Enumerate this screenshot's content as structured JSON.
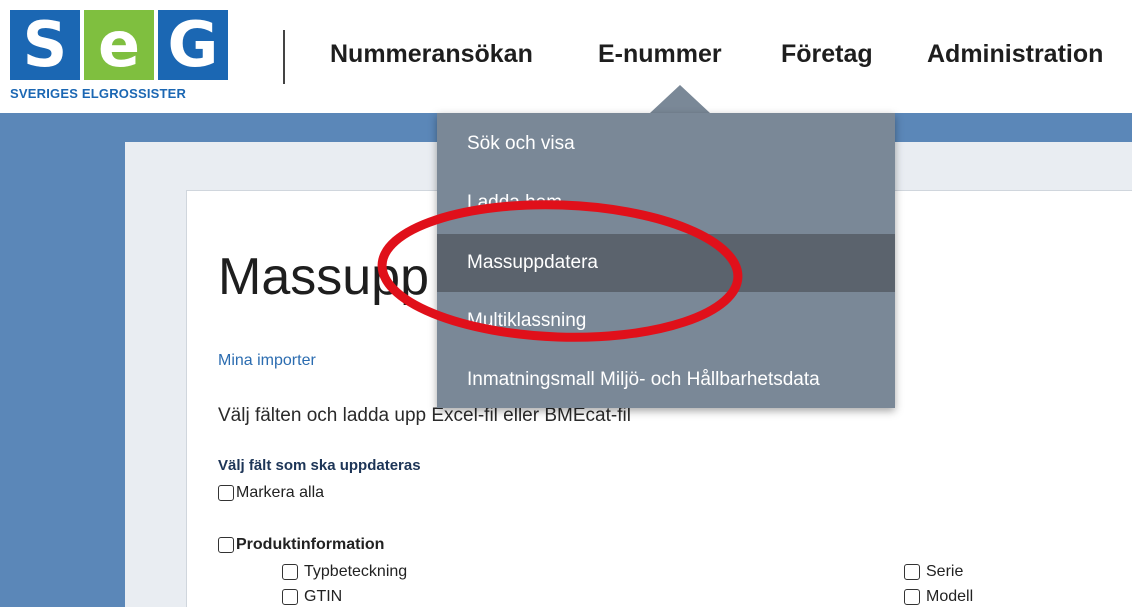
{
  "logo": {
    "letters": [
      "S",
      "e",
      "G"
    ],
    "subtitle": "SVERIGES ELGROSSISTER"
  },
  "nav": {
    "items": [
      "Nummeransökan",
      "E-nummer",
      "Företag",
      "Administration"
    ]
  },
  "dropdown": {
    "items": [
      "Sök och visa",
      "Ladda hem",
      "Massuppdatera",
      "Multiklassning",
      "Inmatningsmall Miljö- och Hållbarhetsdata"
    ],
    "active_index": 2
  },
  "page": {
    "title": "Massupp",
    "link": "Mina importer",
    "instruction": "Välj fälten och ladda upp Excel-fil eller BMEcat-fil",
    "section_label": "Välj fält som ska uppdateras",
    "select_all": "Markera alla",
    "group": "Produktinformation",
    "fields_left": [
      "Typbeteckning",
      "GTIN"
    ],
    "fields_right": [
      "Serie",
      "Modell"
    ]
  },
  "colors": {
    "brand_blue": "#1b67b3",
    "brand_green": "#7fbf3f",
    "band": "#5b87b8",
    "menu": "#7a8897",
    "menu_active": "#5b636d",
    "annotation": "#e0101a"
  }
}
